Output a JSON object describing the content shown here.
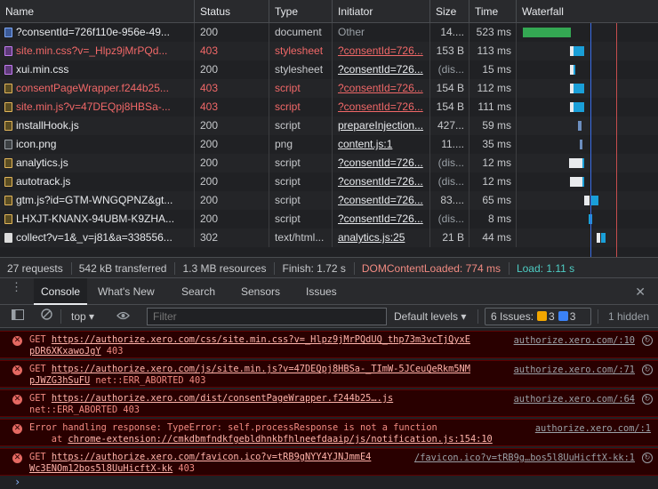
{
  "network": {
    "columns": {
      "name": "Name",
      "status": "Status",
      "type": "Type",
      "initiator": "Initiator",
      "size": "Size",
      "time": "Time",
      "waterfall": "Waterfall"
    },
    "rows": [
      {
        "name": "?consentId=726f110e-956e-49...",
        "status": "200",
        "type": "document",
        "initiator": "Other",
        "size": "14....",
        "time": "523 ms",
        "icon": "doc-icon",
        "error": false
      },
      {
        "name": "site.min.css?v=_Hlpz9jMrPQd...",
        "status": "403",
        "type": "stylesheet",
        "initiator": "?consentId=726...",
        "size": "153 B",
        "time": "113 ms",
        "icon": "css-icon",
        "error": true
      },
      {
        "name": "xui.min.css",
        "status": "200",
        "type": "stylesheet",
        "initiator": "?consentId=726...",
        "size": "(dis...",
        "time": "15 ms",
        "icon": "css-icon",
        "error": false
      },
      {
        "name": "consentPageWrapper.f244b25...",
        "status": "403",
        "type": "script",
        "initiator": "?consentId=726...",
        "size": "154 B",
        "time": "112 ms",
        "icon": "js-icon",
        "error": true
      },
      {
        "name": "site.min.js?v=47DEQpj8HBSa-...",
        "status": "403",
        "type": "script",
        "initiator": "?consentId=726...",
        "size": "154 B",
        "time": "111 ms",
        "icon": "js-icon",
        "error": true
      },
      {
        "name": "installHook.js",
        "status": "200",
        "type": "script",
        "initiator": "prepareInjection...",
        "size": "427...",
        "time": "59 ms",
        "icon": "js-icon",
        "error": false
      },
      {
        "name": "icon.png",
        "status": "200",
        "type": "png",
        "initiator": "content.js:1",
        "size": "11....",
        "time": "35 ms",
        "icon": "image-icon",
        "error": false
      },
      {
        "name": "analytics.js",
        "status": "200",
        "type": "script",
        "initiator": "?consentId=726...",
        "size": "(dis...",
        "time": "12 ms",
        "icon": "js-icon",
        "error": false
      },
      {
        "name": "autotrack.js",
        "status": "200",
        "type": "script",
        "initiator": "?consentId=726...",
        "size": "(dis...",
        "time": "12 ms",
        "icon": "js-icon",
        "error": false
      },
      {
        "name": "gtm.js?id=GTM-WNGQPNZ&gt...",
        "status": "200",
        "type": "script",
        "initiator": "?consentId=726...",
        "size": "83....",
        "time": "65 ms",
        "icon": "js-icon",
        "error": false
      },
      {
        "name": "LHXJT-KNANX-94UBM-K9ZHA...",
        "status": "200",
        "type": "script",
        "initiator": "?consentId=726...",
        "size": "(dis...",
        "time": "8 ms",
        "icon": "js-icon",
        "error": false
      },
      {
        "name": "collect?v=1&_v=j81&a=338556...",
        "status": "302",
        "type": "text/html...",
        "initiator": "analytics.js:25",
        "size": "21 B",
        "time": "44 ms",
        "icon": "gif-icon",
        "error": false
      }
    ],
    "summary": {
      "requests": "27 requests",
      "transferred": "542 kB transferred",
      "resources": "1.3 MB resources",
      "finish": "Finish: 1.72 s",
      "dom_loaded": "DOMContentLoaded: 774 ms",
      "load": "Load: 1.11 s"
    }
  },
  "drawer": {
    "tabs": [
      "Console",
      "What's New",
      "Search",
      "Sensors",
      "Issues"
    ],
    "active_tab": "Console"
  },
  "console_toolbar": {
    "context": "top",
    "filter_placeholder": "Filter",
    "levels": "Default levels",
    "issues_label": "6 Issues:",
    "issues_warn": "3",
    "issues_info": "3",
    "hidden": "1 hidden"
  },
  "messages": [
    {
      "line1_prefix": "GET ",
      "line1_url": "https://authorize.xero.com/css/site.min.css?v=_Hlpz9jMrPQdUQ_thp73m3vcTjQyxE",
      "line2_url": "pDR6XKxawoJgY",
      "line2_rest": " 403",
      "source": "authorize.xero.com/:10"
    },
    {
      "line1_prefix": "GET ",
      "line1_url": "https://authorize.xero.com/js/site.min.js?v=47DEQpj8HBSa-_TImW-5JCeuQeRkm5NM",
      "line2_url": "pJWZG3hSuFU",
      "line2_rest": " net::ERR_ABORTED 403",
      "source": "authorize.xero.com/:71"
    },
    {
      "line1_prefix": "GET ",
      "line1_url": "https://authorize.xero.com/dist/consentPageWrapper.f244b25….js",
      "line2_url": "",
      "line2_rest": "net::ERR_ABORTED 403",
      "source": "authorize.xero.com/:64"
    },
    {
      "line1_prefix": "Error handling response: TypeError: self.processResponse is not a function",
      "line1_url": "",
      "line2_prefix": "    at ",
      "line2_url": "chrome-extension://cmkdbmfndkfgebldhnkbfhlneefdaaip/js/notification.js:154:10",
      "line2_rest": "",
      "source": "authorize.xero.com/:1"
    },
    {
      "line1_prefix": "GET ",
      "line1_url": "https://authorize.xero.com/favicon.ico?v=tRB9gNYY4YJNJmmE4",
      "line2_url": "Wc3ENOm12bos5l8UuHicftX-kk",
      "line2_rest": " 403",
      "source": "/favicon.ico?v=tRB9g…bos5l8UuHicftX-kk:1"
    }
  ],
  "colors": {
    "error_text": "#f16868",
    "dcl": "#f28b82",
    "load": "#4ecdc4",
    "accent": "#8ab4f8"
  }
}
